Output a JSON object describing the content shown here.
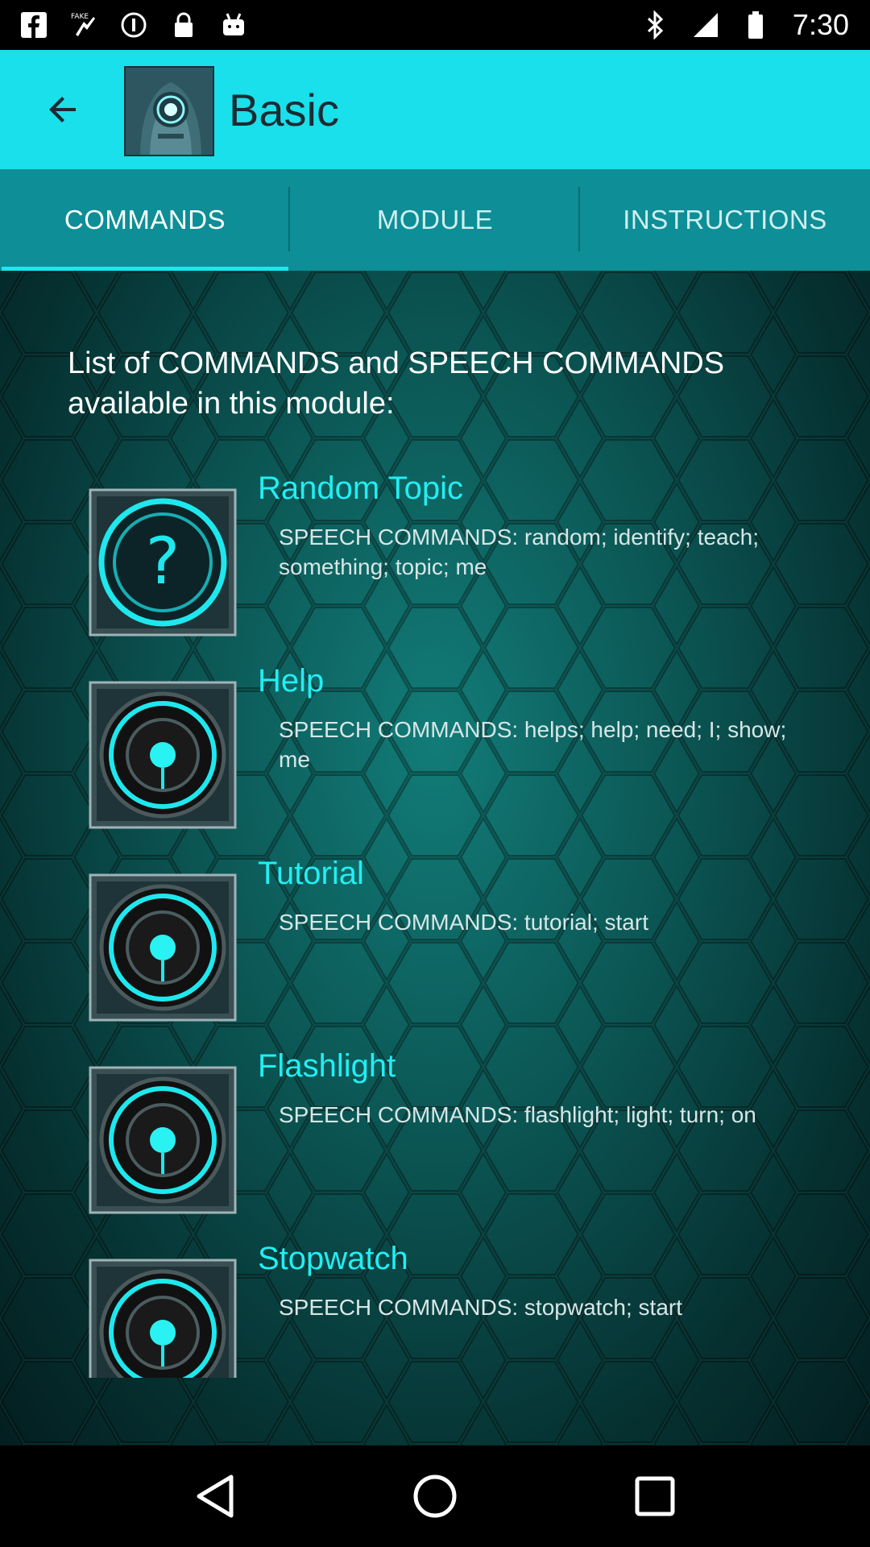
{
  "status_bar": {
    "time": "7:30",
    "left_icons": [
      "facebook-icon",
      "fake-gps-icon",
      "info-circle-icon",
      "lock-icon",
      "android-icon"
    ],
    "right_icons": [
      "bluetooth-icon",
      "signal-icon",
      "battery-icon"
    ]
  },
  "app_bar": {
    "title": "Basic",
    "back_icon": "arrow-back-icon",
    "color": "#19e0ea"
  },
  "tabs": [
    {
      "label": "COMMANDS",
      "active": true
    },
    {
      "label": "MODULE",
      "active": false
    },
    {
      "label": "INSTRUCTIONS",
      "active": false
    }
  ],
  "content": {
    "intro": "List of COMMANDS and SPEECH COMMANDS available in this module:",
    "commands": [
      {
        "title": "Random Topic",
        "desc": "SPEECH COMMANDS: random; identify; teach; something; topic; me",
        "icon": "question-target-icon"
      },
      {
        "title": "Help",
        "desc": "SPEECH COMMANDS: helps; help; need; I; show; me",
        "icon": "target-icon"
      },
      {
        "title": "Tutorial",
        "desc": "SPEECH COMMANDS: tutorial; start",
        "icon": "target-icon"
      },
      {
        "title": "Flashlight",
        "desc": "SPEECH COMMANDS: flashlight; light; turn; on",
        "icon": "target-icon"
      },
      {
        "title": "Stopwatch",
        "desc": "SPEECH COMMANDS: stopwatch; start",
        "icon": "target-icon"
      }
    ]
  },
  "nav_bar": {
    "icons": [
      "nav-back-icon",
      "nav-home-icon",
      "nav-recents-icon"
    ]
  }
}
